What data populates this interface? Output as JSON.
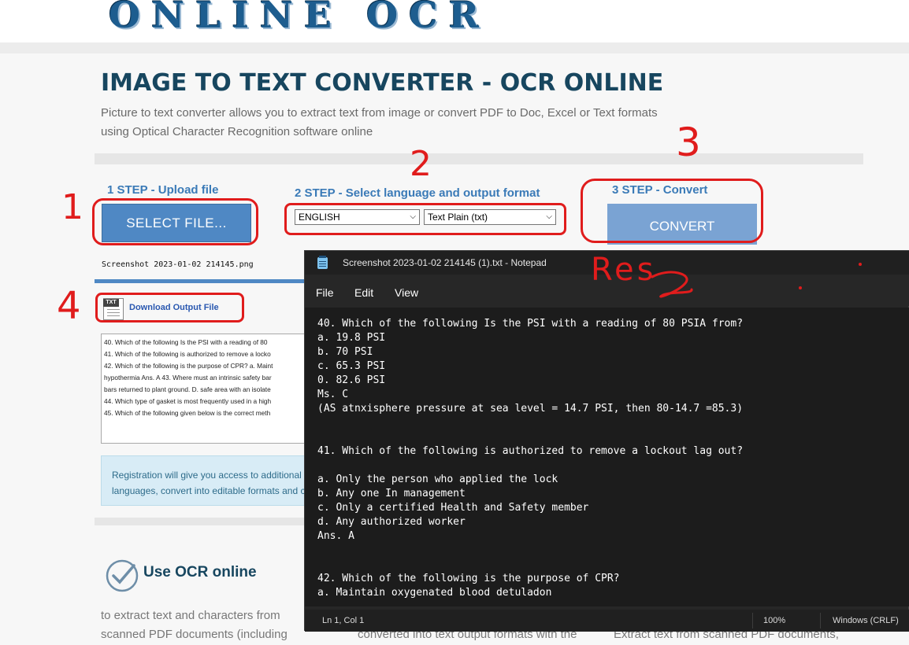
{
  "site": {
    "logo_text": "ONLINE OCR",
    "title": "IMAGE TO TEXT CONVERTER - OCR ONLINE",
    "subtitle_line1": "Picture to text converter allows you to extract text from image or convert PDF to Doc, Excel or Text formats",
    "subtitle_line2": "using Optical Character Recognition software online",
    "step1_title": "1 STEP - Upload file",
    "step2_title": "2 STEP - Select language and output format",
    "step3_title": "3 STEP - Convert",
    "select_file_label": "SELECT FILE...",
    "language_value": "ENGLISH",
    "format_value": "Text Plain (txt)",
    "convert_label": "CONVERT",
    "uploaded_filename": "Screenshot 2023-01-02 214145.png",
    "download_label": "Download Output File",
    "txt_badge": "TXT",
    "ocr_preview_lines": [
      "40. Which of the following Is the PSI with a reading of 80",
      "41. Which of the following is authorized to remove a locko",
      "42. Which of the following is the purpose of CPR? a. Maint",
      "hypothermia Ans. A 43. Where must an intrinsic safety bar",
      "bars returned to plant ground. D. safe area with an isolate",
      "44. Which type of gasket is most frequently used in a high",
      "45. Which of the following given below is the correct meth"
    ],
    "registration_line1": "Registration will give you access to additional",
    "registration_line2": "languages, convert into editable formats and c",
    "use_ocr_heading": "Use OCR online",
    "body_text_1": "to extract text and characters from",
    "body_text_2": "scanned PDF documents (including",
    "body_text_3": "converted into text output formats with the",
    "body_text_4": "Extract text from scanned PDF documents,"
  },
  "annotations": {
    "num1": "1",
    "num2": "2",
    "num3": "3",
    "num4": "4",
    "result_text": "Res"
  },
  "notepad": {
    "title": "Screenshot 2023-01-02 214145 (1).txt - Notepad",
    "menu": {
      "file": "File",
      "edit": "Edit",
      "view": "View"
    },
    "lines": [
      "40. Which of the following Is the PSI with a reading of 80 PSIA from?",
      "a. 19.8 PSI",
      "b. 70 PSI",
      "c. 65.3 PSI",
      "0. 82.6 PSI",
      "Ms. C",
      "(AS atnxisphere pressure at sea level = 14.7 PSI, then 80-14.7 =85.3)",
      "",
      "",
      "41. Which of the following is authorized to remove a lockout lag out?",
      "",
      "a. Only the person who applied the lock",
      "b. Any one In management",
      "c. Only a certified Health and Safety member",
      "d. Any authorized worker",
      "Ans. A",
      "",
      "",
      "42. Which of the following is the purpose of CPR?",
      "a. Maintain oxygenated blood detuladon"
    ],
    "status_position": "Ln 1, Col 1",
    "status_zoom": "100%",
    "status_line_ending": "Windows (CRLF)"
  },
  "colors": {
    "title_blue": "#17465f",
    "step_blue": "#3a7ab7",
    "button_blue": "#4f88c4",
    "convert_blue": "#7aa3d3",
    "annotation_red": "#e01c1c",
    "notepad_bg": "#1c1c1c"
  }
}
